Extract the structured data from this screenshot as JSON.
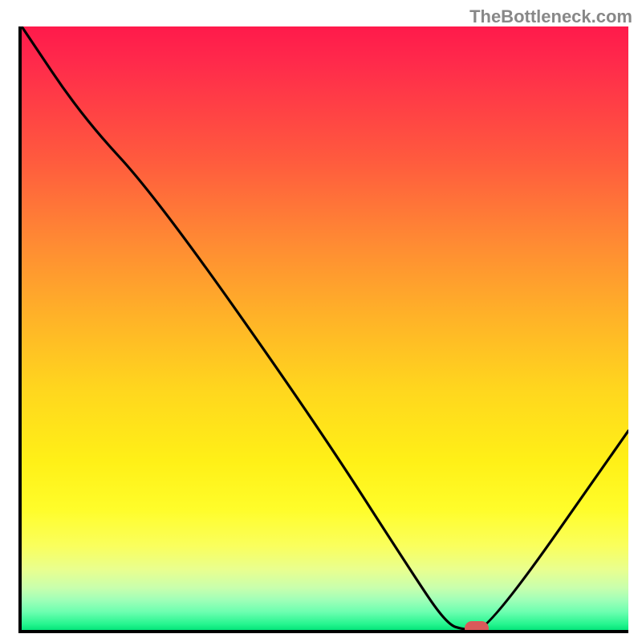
{
  "attribution": "TheBottleneck.com",
  "chart_data": {
    "type": "line",
    "title": "",
    "xlabel": "",
    "ylabel": "",
    "xlim": [
      0,
      100
    ],
    "ylim": [
      0,
      100
    ],
    "x": [
      0,
      10,
      22,
      48,
      64,
      70,
      73,
      77,
      100
    ],
    "values": [
      100,
      85,
      72,
      35,
      10,
      1,
      0,
      0,
      33
    ],
    "marker": {
      "x_start": 73,
      "x_end": 77,
      "y": 0
    },
    "curve_note": "V-shaped bottleneck curve; dip near x≈73–77 marks optimal match"
  },
  "colors": {
    "gradient_top": "#ff1a4b",
    "gradient_bottom": "#05e57a",
    "marker": "#d95a5a"
  }
}
